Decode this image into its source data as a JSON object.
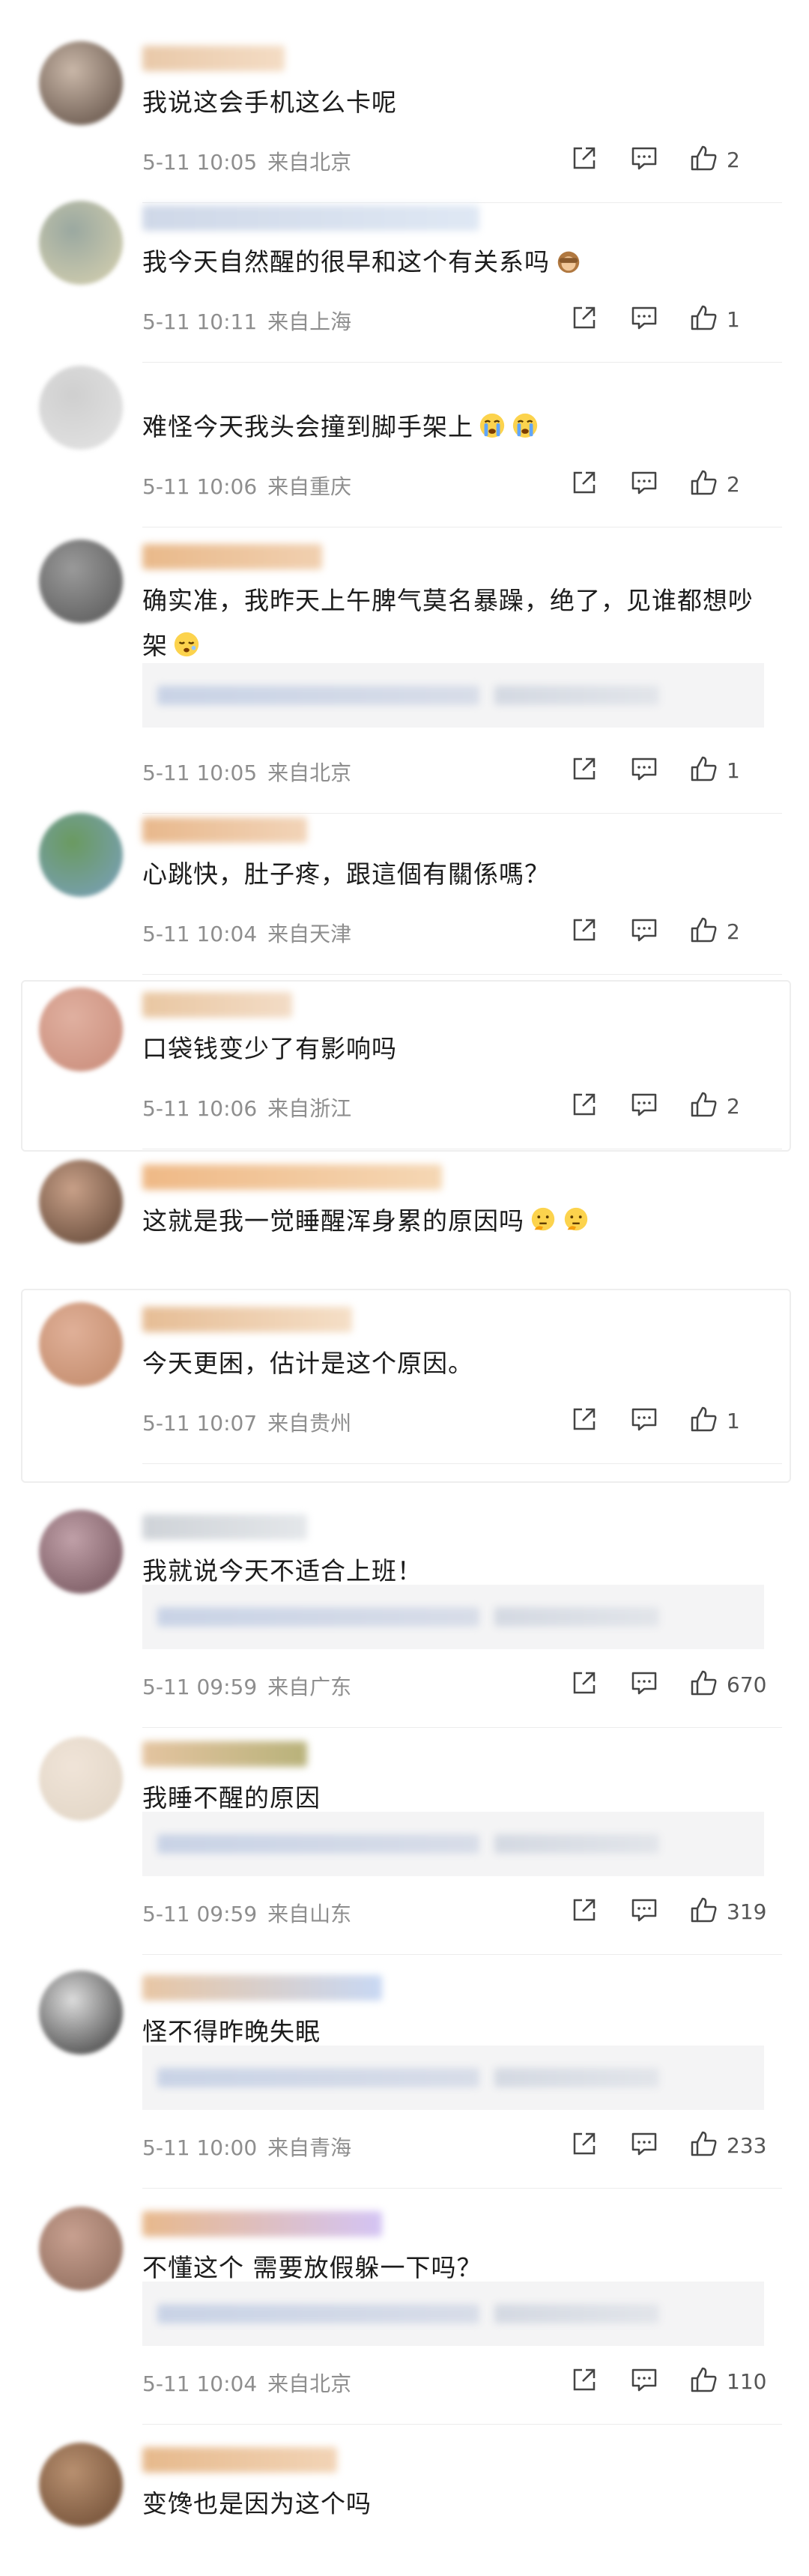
{
  "comments": [
    {
      "text": "我说这会手机这么卡呢",
      "time": "5-11 10:05",
      "location": "来自北京",
      "likes": "2",
      "emoji": []
    },
    {
      "text": "我今天自然醒的很早和这个有关系吗",
      "time": "5-11 10:11",
      "location": "来自上海",
      "likes": "1",
      "emoji": [
        "monkey-icon"
      ]
    },
    {
      "text": "难怪今天我头会撞到脚手架上",
      "time": "5-11 10:06",
      "location": "来自重庆",
      "likes": "2",
      "emoji": [
        "crying-face-icon",
        "crying-face-icon"
      ]
    },
    {
      "text": "确实准，我昨天上午脾气莫名暴躁，绝了，见谁都想吵架",
      "time": "5-11 10:05",
      "location": "来自北京",
      "likes": "1",
      "emoji": [
        "sleepy-face-icon"
      ]
    },
    {
      "text": "心跳快，肚子疼，跟這個有關係嗎？",
      "time": "5-11 10:04",
      "location": "来自天津",
      "likes": "2",
      "emoji": []
    },
    {
      "text": "口袋钱变少了有影响吗",
      "time": "5-11 10:06",
      "location": "来自浙江",
      "likes": "2",
      "emoji": []
    },
    {
      "text": "这就是我一觉睡醒浑身累的原因吗",
      "time": "",
      "location": "",
      "likes": "",
      "emoji": [
        "thinking-face-icon",
        "thinking-face-icon"
      ]
    },
    {
      "text": "今天更困，估计是这个原因。",
      "time": "5-11 10:07",
      "location": "来自贵州",
      "likes": "1",
      "emoji": []
    },
    {
      "text": "我就说今天不适合上班！",
      "time": "5-11 09:59",
      "location": "来自广东",
      "likes": "670",
      "emoji": []
    },
    {
      "text": "我睡不醒的原因",
      "time": "5-11 09:59",
      "location": "来自山东",
      "likes": "319",
      "emoji": []
    },
    {
      "text": "怪不得昨晚失眠",
      "time": "5-11 10:00",
      "location": "来自青海",
      "likes": "233",
      "emoji": []
    },
    {
      "text": "不懂这个 需要放假躲一下吗？",
      "time": "5-11 10:04",
      "location": "来自北京",
      "likes": "110",
      "emoji": []
    },
    {
      "text": "变馋也是因为这个吗",
      "time": "",
      "location": "",
      "likes": "",
      "emoji": []
    }
  ],
  "icons": {
    "share": "share-icon",
    "comment": "comment-icon",
    "like": "thumbs-up-icon"
  },
  "colors": {
    "meta": "#8e8e8e",
    "text": "#1c1c1c",
    "divider": "#ececec",
    "reply_bg": "#f4f4f5"
  }
}
